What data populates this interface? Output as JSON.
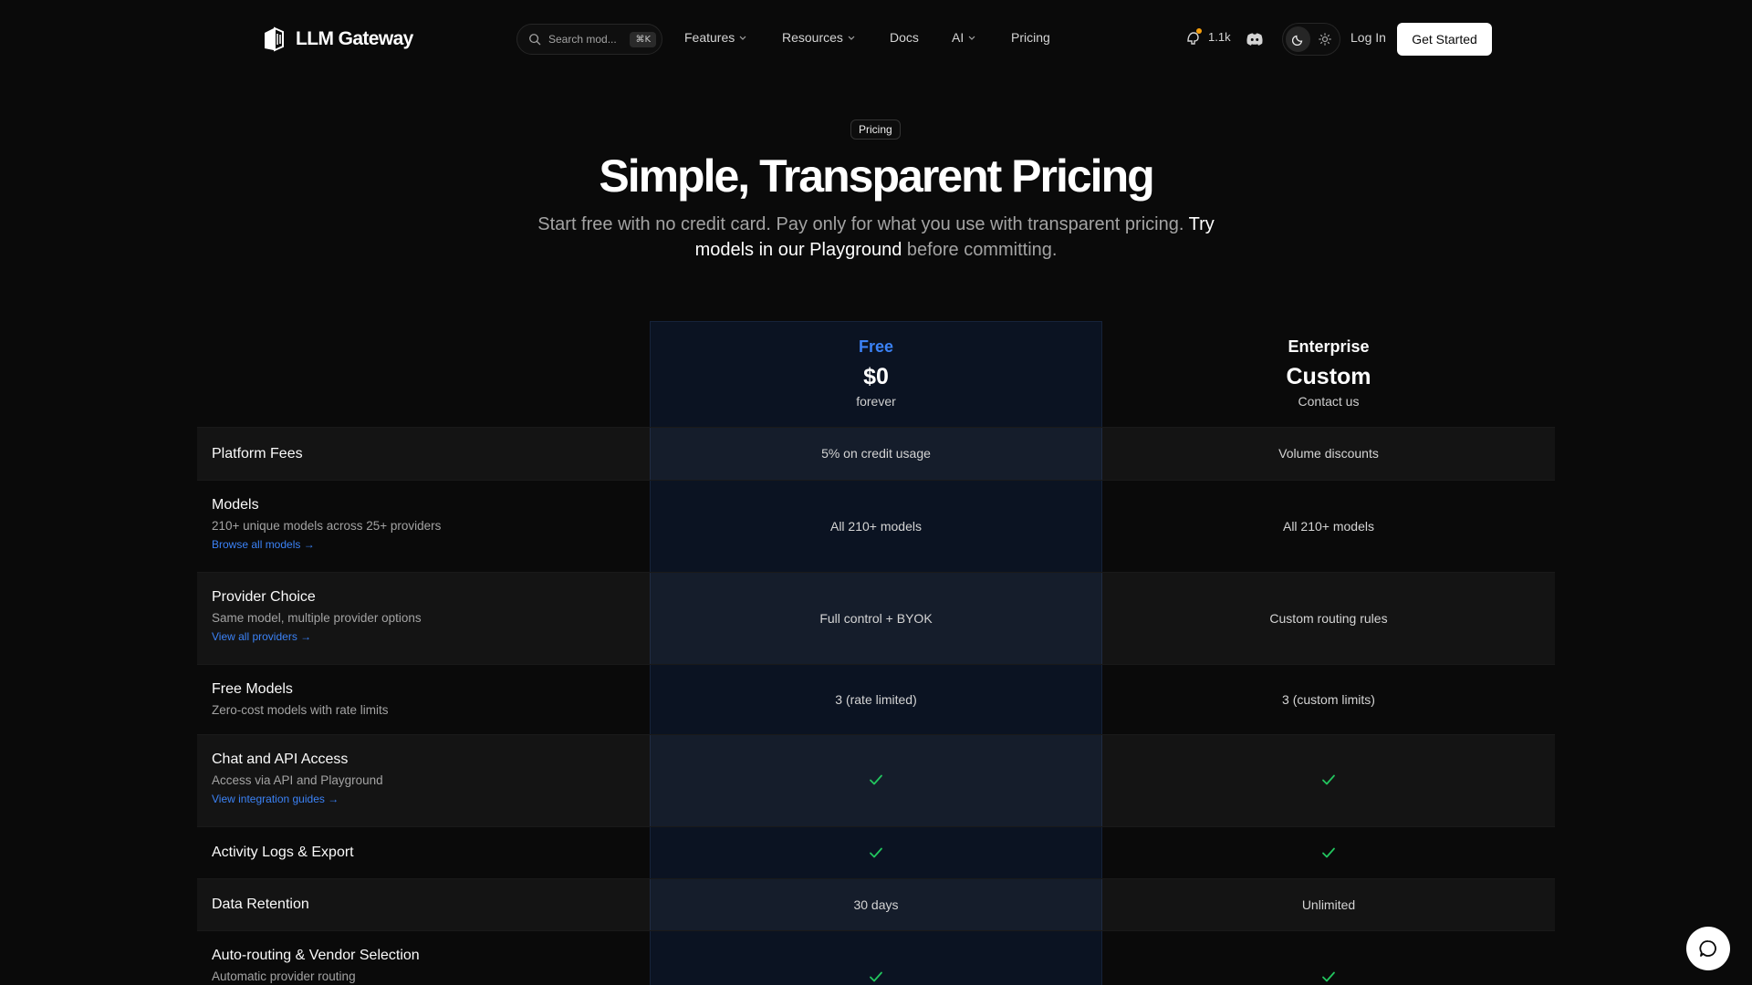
{
  "nav": {
    "brand": "LLM Gateway",
    "search_placeholder": "Search mod...",
    "search_shortcut": "⌘K",
    "items": [
      {
        "label": "Features",
        "has_dropdown": true
      },
      {
        "label": "Resources",
        "has_dropdown": true
      },
      {
        "label": "Docs",
        "has_dropdown": false
      },
      {
        "label": "AI",
        "has_dropdown": true
      },
      {
        "label": "Pricing",
        "has_dropdown": false
      }
    ],
    "github_stars": "1.1k",
    "login_label": "Log In",
    "cta_label": "Get Started",
    "accent_color": "#3b82f6"
  },
  "hero": {
    "badge": "Pricing",
    "title": "Simple, Transparent Pricing",
    "subtitle_start": "Start free with no credit card. Pay only for what you use with transparent pricing.",
    "subtitle_link": "Try models in our Playground",
    "subtitle_end": "before committing."
  },
  "plans": [
    {
      "name": "Free",
      "price": "$0",
      "note": "forever"
    },
    {
      "name": "Enterprise",
      "price": "Custom",
      "note": "Contact us"
    }
  ],
  "features": [
    {
      "title": "Platform Fees",
      "desc": "",
      "link": "",
      "free": "5% on credit usage",
      "enterprise": "Volume discounts"
    },
    {
      "title": "Models",
      "desc": "210+ unique models across 25+ providers",
      "link": "Browse all models →",
      "free": "All 210+ models",
      "enterprise": "All 210+ models"
    },
    {
      "title": "Provider Choice",
      "desc": "Same model, multiple provider options",
      "link": "View all providers →",
      "free": "Full control + BYOK",
      "enterprise": "Custom routing rules"
    },
    {
      "title": "Free Models",
      "desc": "Zero-cost models with rate limits",
      "link": "",
      "free": "3 (rate limited)",
      "enterprise": "3 (custom limits)"
    },
    {
      "title": "Chat and API Access",
      "desc": "Access via API and Playground",
      "link": "View integration guides →",
      "free": "check",
      "enterprise": "check"
    },
    {
      "title": "Activity Logs & Export",
      "desc": "",
      "link": "",
      "free": "check",
      "enterprise": "check"
    },
    {
      "title": "Data Retention",
      "desc": "",
      "link": "",
      "free": "30 days",
      "enterprise": "Unlimited"
    },
    {
      "title": "Auto-routing & Vendor Selection",
      "desc": "Automatic provider routing",
      "link": "",
      "free": "check",
      "enterprise": "check"
    }
  ],
  "icons": {
    "check_color": "#22c55e"
  }
}
